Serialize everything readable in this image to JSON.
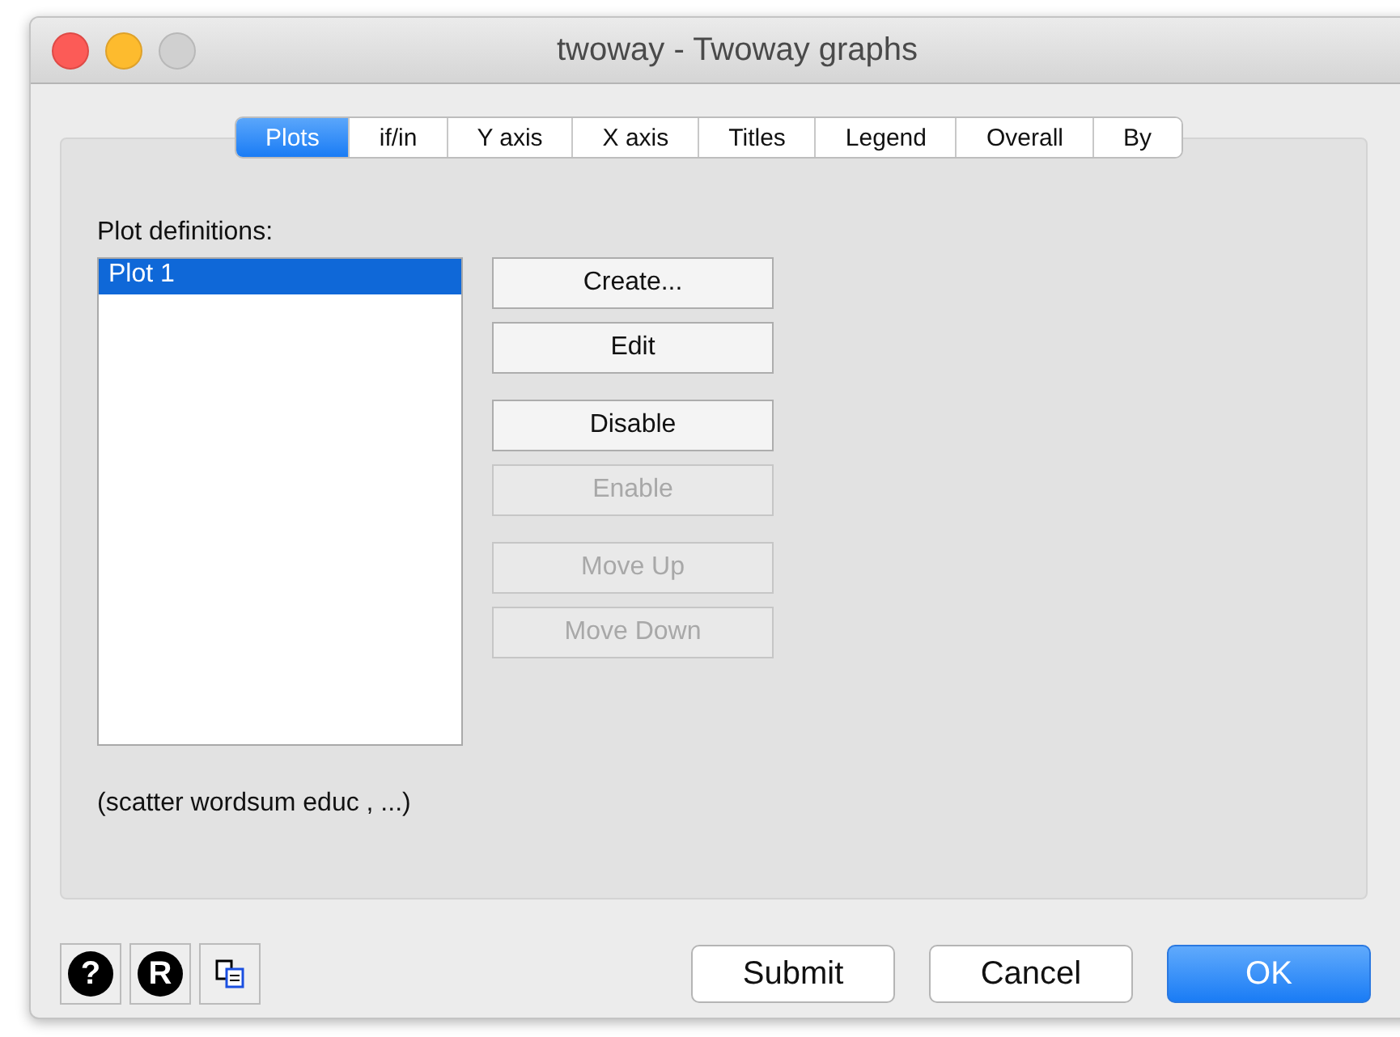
{
  "window": {
    "title": "twoway - Twoway graphs"
  },
  "tabs": [
    {
      "label": "Plots",
      "selected": true
    },
    {
      "label": "if/in",
      "selected": false
    },
    {
      "label": "Y axis",
      "selected": false
    },
    {
      "label": "X axis",
      "selected": false
    },
    {
      "label": "Titles",
      "selected": false
    },
    {
      "label": "Legend",
      "selected": false
    },
    {
      "label": "Overall",
      "selected": false
    },
    {
      "label": "By",
      "selected": false
    }
  ],
  "plot_definitions": {
    "label": "Plot definitions:",
    "items": [
      {
        "label": "Plot 1",
        "selected": true
      }
    ]
  },
  "action_groups": [
    [
      {
        "label": "Create...",
        "disabled": false
      },
      {
        "label": "Edit",
        "disabled": false
      }
    ],
    [
      {
        "label": "Disable",
        "disabled": false
      },
      {
        "label": "Enable",
        "disabled": true
      }
    ],
    [
      {
        "label": "Move Up",
        "disabled": true
      },
      {
        "label": "Move Down",
        "disabled": true
      }
    ]
  ],
  "command_preview": "(scatter wordsum educ , ...)",
  "icon_buttons": [
    {
      "kind": "help",
      "label": "?"
    },
    {
      "kind": "reset",
      "label": "R"
    },
    {
      "kind": "copy"
    }
  ],
  "buttons": [
    {
      "label": "Submit",
      "kind": "normal"
    },
    {
      "label": "Cancel",
      "kind": "normal"
    },
    {
      "label": "OK",
      "kind": "default"
    }
  ]
}
